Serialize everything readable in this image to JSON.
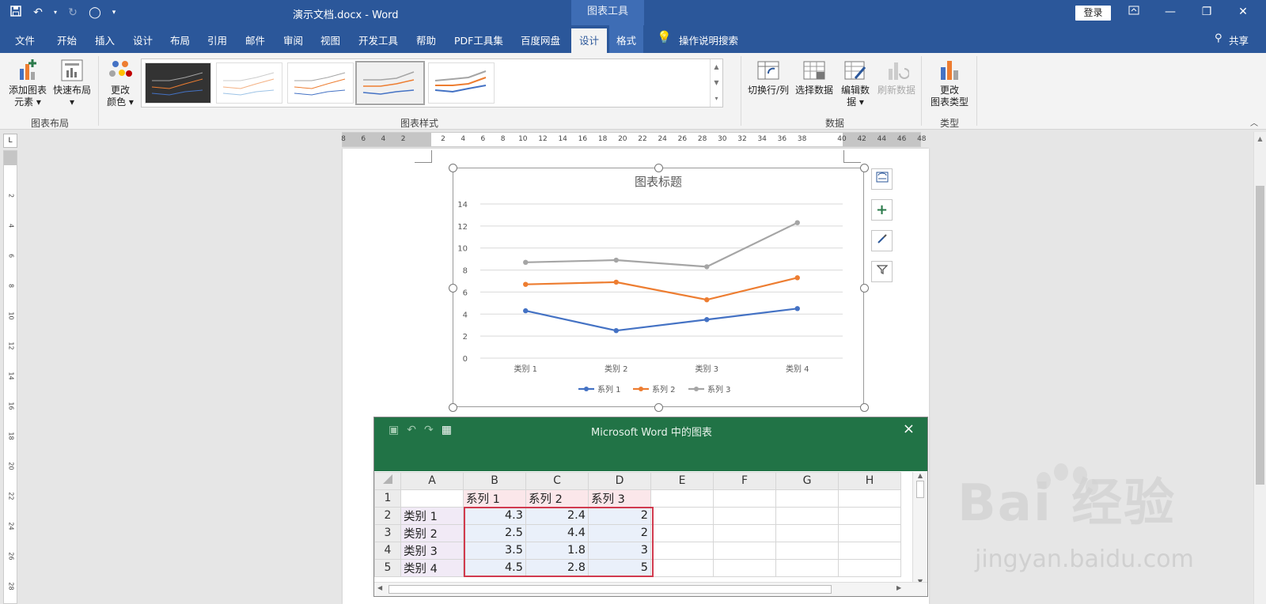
{
  "window": {
    "doc_title": "演示文档.docx  -  Word",
    "context_tab": "图表工具",
    "login": "登录",
    "min_icon": "minimize-icon",
    "restore_icon": "restore-icon",
    "close_icon": "close-icon"
  },
  "tabs": {
    "file": "文件",
    "home": "开始",
    "insert": "插入",
    "design1": "设计",
    "layout": "布局",
    "refs": "引用",
    "mail": "邮件",
    "review": "审阅",
    "view": "视图",
    "dev": "开发工具",
    "help": "帮助",
    "pdf": "PDF工具集",
    "baidu": "百度网盘",
    "chart_design": "设计",
    "chart_format": "格式",
    "search": "操作说明搜索",
    "share": "共享"
  },
  "ribbon": {
    "add_element": [
      "添加图表",
      "元素 ▾"
    ],
    "quick_layout": [
      "快速布局",
      "▾"
    ],
    "change_color": [
      "更改",
      "颜色 ▾"
    ],
    "switch_row_col": "切换行/列",
    "select_data": "选择数据",
    "edit_data": [
      "编辑数",
      "据 ▾"
    ],
    "refresh_data": "刷新数据",
    "change_type": [
      "更改",
      "图表类型"
    ],
    "group_layout": "图表布局",
    "group_styles": "图表样式",
    "group_data": "数据",
    "group_type": "类型"
  },
  "ruler": {
    "h_ticks": [
      "8",
      "6",
      "4",
      "2",
      "",
      "2",
      "4",
      "6",
      "8",
      "10",
      "12",
      "14",
      "16",
      "18",
      "20",
      "22",
      "24",
      "26",
      "28",
      "30",
      "32",
      "34",
      "36",
      "38",
      "",
      "40",
      "42",
      "44",
      "46",
      "48"
    ],
    "v_ticks": [
      "2",
      "4",
      "6",
      "8",
      "10",
      "12",
      "14",
      "16",
      "18",
      "20",
      "22",
      "24",
      "26",
      "28"
    ]
  },
  "chart_data": {
    "type": "line",
    "title": "图表标题",
    "categories": [
      "类别 1",
      "类别 2",
      "类别 3",
      "类别 4"
    ],
    "ylim": [
      0,
      14
    ],
    "yticks": [
      "0",
      "2",
      "4",
      "6",
      "8",
      "10",
      "12",
      "14"
    ],
    "grid": true,
    "legend": "bottom",
    "series": [
      {
        "name": "系列 1",
        "values": [
          4.3,
          2.5,
          3.5,
          4.5
        ],
        "color": "#4472c4"
      },
      {
        "name": "系列 2",
        "values": [
          6.7,
          6.9,
          5.3,
          7.3
        ],
        "color": "#ed7d31"
      },
      {
        "name": "系列 3",
        "values": [
          8.7,
          8.9,
          8.3,
          12.3
        ],
        "color": "#a5a5a5"
      }
    ]
  },
  "excel": {
    "title": "Microsoft Word 中的图表",
    "col_headers": [
      "A",
      "B",
      "C",
      "D",
      "E",
      "F",
      "G",
      "H"
    ],
    "rows": [
      [
        "1",
        "",
        "系列 1",
        "系列 2",
        "系列 3",
        "",
        "",
        "",
        ""
      ],
      [
        "2",
        "类别 1",
        "4.3",
        "2.4",
        "2",
        "",
        "",
        "",
        ""
      ],
      [
        "3",
        "类别 2",
        "2.5",
        "4.4",
        "2",
        "",
        "",
        "",
        ""
      ],
      [
        "4",
        "类别 3",
        "3.5",
        "1.8",
        "3",
        "",
        "",
        "",
        ""
      ],
      [
        "5",
        "类别 4",
        "4.5",
        "2.8",
        "5",
        "",
        "",
        "",
        ""
      ]
    ]
  },
  "watermark": {
    "brand": "Bai  经验",
    "url": "jingyan.baidu.com"
  }
}
